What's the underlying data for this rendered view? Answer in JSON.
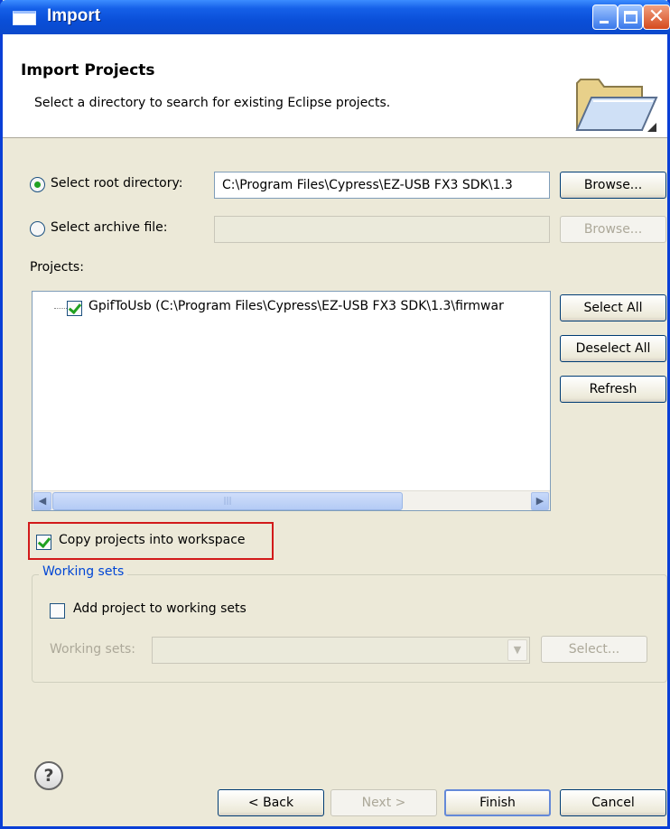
{
  "window": {
    "title": "Import"
  },
  "header": {
    "title": "Import Projects",
    "description": "Select a directory to search for existing Eclipse projects."
  },
  "source": {
    "root_label": "Select root directory:",
    "root_value": "C:\\Program Files\\Cypress\\EZ-USB FX3 SDK\\1.3",
    "root_selected": true,
    "archive_label": "Select archive file:",
    "archive_value": "",
    "archive_selected": false,
    "browse_label": "Browse..."
  },
  "projects": {
    "label": "Projects:",
    "items": [
      {
        "label": "GpifToUsb (C:\\Program Files\\Cypress\\EZ-USB FX3 SDK\\1.3\\firmwar",
        "checked": true
      }
    ],
    "select_all_label": "Select All",
    "deselect_all_label": "Deselect All",
    "refresh_label": "Refresh"
  },
  "options": {
    "copy_label": "Copy projects into workspace",
    "copy_checked": true
  },
  "working_sets": {
    "legend": "Working sets",
    "add_label": "Add project to working sets",
    "add_checked": false,
    "field_label": "Working sets:",
    "field_value": "",
    "select_label": "Select..."
  },
  "footer": {
    "help_glyph": "?",
    "back_label": "< Back",
    "next_label": "Next >",
    "finish_label": "Finish",
    "cancel_label": "Cancel"
  },
  "colors": {
    "title_bar": "#0a4fd8",
    "highlight_border": "#d21a1a",
    "check_green": "#21a121",
    "group_legend": "#0046d5"
  }
}
